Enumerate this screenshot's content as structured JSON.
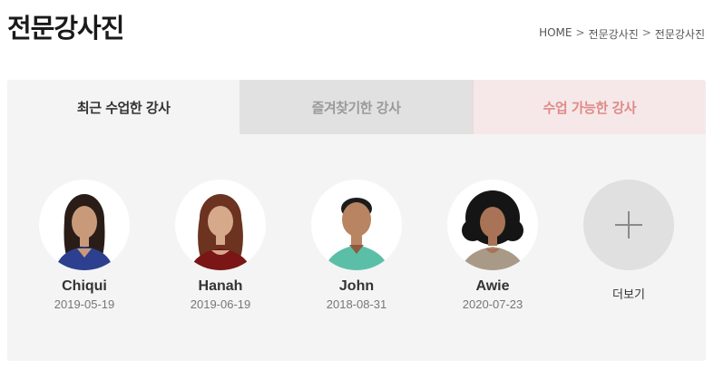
{
  "header": {
    "title": "전문강사진",
    "breadcrumb": [
      "HOME",
      "전문강사진",
      "전문강사진"
    ],
    "separator": ">"
  },
  "tabs": [
    {
      "label": "최근 수업한 강사",
      "active": true
    },
    {
      "label": "즐겨찾기한 강사",
      "active": false
    },
    {
      "label": "수업 가능한 강사",
      "active": false
    }
  ],
  "teachers": [
    {
      "name": "Chiqui",
      "date": "2019-05-19",
      "hair": "#2a1d18",
      "shirt": "#2d3f8f",
      "skin": "#c99a7a"
    },
    {
      "name": "Hanah",
      "date": "2019-06-19",
      "hair": "#6b3320",
      "shirt": "#7a1616",
      "skin": "#d6a98a"
    },
    {
      "name": "John",
      "date": "2018-08-31",
      "hair": "#1c1c1c",
      "shirt": "#5bbfa8",
      "skin": "#b88462"
    },
    {
      "name": "Awie",
      "date": "2020-07-23",
      "hair": "#151515",
      "shirt": "#a89a87",
      "skin": "#a87356"
    }
  ],
  "more": {
    "label": "더보기",
    "icon": "plus-icon"
  },
  "colors": {
    "panel_bg": "#f4f4f4",
    "tab_favorite_bg": "#e1e1e1",
    "tab_available_text": "#e08a8a"
  }
}
